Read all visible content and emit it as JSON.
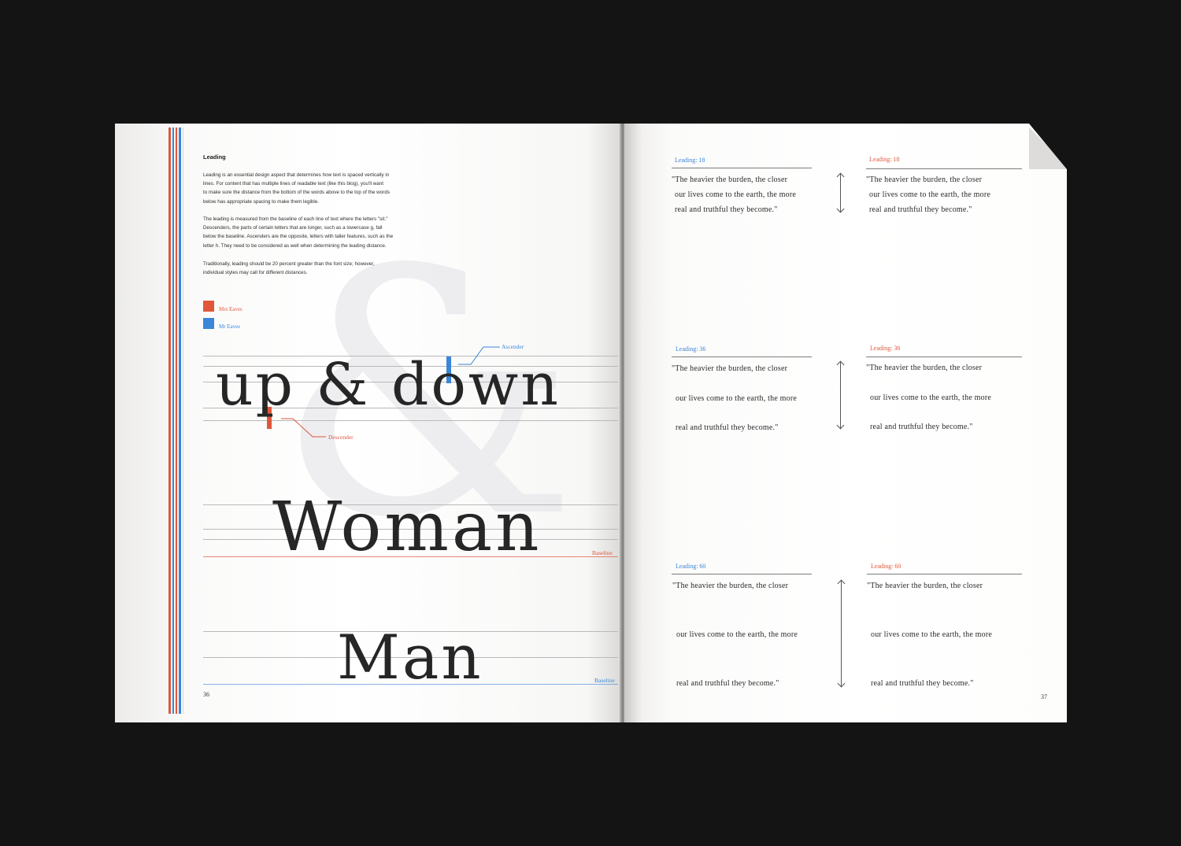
{
  "colors": {
    "mrs_eaves": "#e0573a",
    "mr_eaves": "#3a86d8",
    "text": "#262626"
  },
  "left_page": {
    "heading": "Leading",
    "paragraphs": [
      [
        "Leading is an essential design aspect that determines how text is spaced vertically in",
        "lines. For content that has multiple lines of readable text (like this blog), you'll want",
        "to make sure the distance from the bottom of the words above to the top of the words",
        "below has appropriate spacing to make them legible."
      ],
      [
        "The leading is measured from the baseline of each line of text where the letters \"sit.\"",
        "Descenders, the parts of certain letters that are longer, such as a lowercase g, fall",
        "below the baseline. Ascenders are the opposite, letters with taller features, such as the",
        "letter h. They need to be considered as well when determining the leading distance."
      ],
      [
        "Traditionally, leading should be 20 percent greater than the font size; however,",
        "individual styles may call for different distances."
      ]
    ],
    "legend": [
      {
        "label": "Mrs Eaves",
        "color_key": "mrs_eaves"
      },
      {
        "label": "Mr Eaves",
        "color_key": "mr_eaves"
      }
    ],
    "specimen_1": "up & down",
    "specimen_2": "Woman",
    "specimen_3": "Man",
    "callout_ascender": "Ascender",
    "callout_descender": "Descender",
    "baseline_label_1": "Baseline",
    "baseline_label_2": "Baseline",
    "page_number": "36"
  },
  "right_page": {
    "page_number": "37",
    "cells": [
      {
        "label": "Leading: 18",
        "color_key": "mr_eaves",
        "lines": [
          "\"The heavier the burden, the closer",
          "our lives come to the earth, the more",
          "real and truthful they become.\""
        ]
      },
      {
        "label": "Leading: 18",
        "color_key": "mrs_eaves",
        "lines": [
          "\"The heavier the burden, the closer",
          "our lives come to the earth, the more",
          "real and truthful they become.\""
        ]
      },
      {
        "label": "Leading: 36",
        "color_key": "mr_eaves",
        "lines": [
          "\"The heavier the burden, the closer",
          "our lives come to the earth, the more",
          "real and truthful they become.\""
        ]
      },
      {
        "label": "Leading: 36",
        "color_key": "mrs_eaves",
        "lines": [
          "\"The heavier the burden, the closer",
          "our lives come to the earth, the more",
          "real and truthful they become.\""
        ]
      },
      {
        "label": "Leading: 60",
        "color_key": "mr_eaves",
        "lines": [
          "\"The heavier the burden, the closer",
          "our lives come to the earth, the more",
          "real and truthful they become.\""
        ]
      },
      {
        "label": "Leading: 60",
        "color_key": "mrs_eaves",
        "lines": [
          "\"The heavier the burden, the closer",
          "our lives come to the earth, the more",
          "real and truthful they become.\""
        ]
      }
    ]
  }
}
